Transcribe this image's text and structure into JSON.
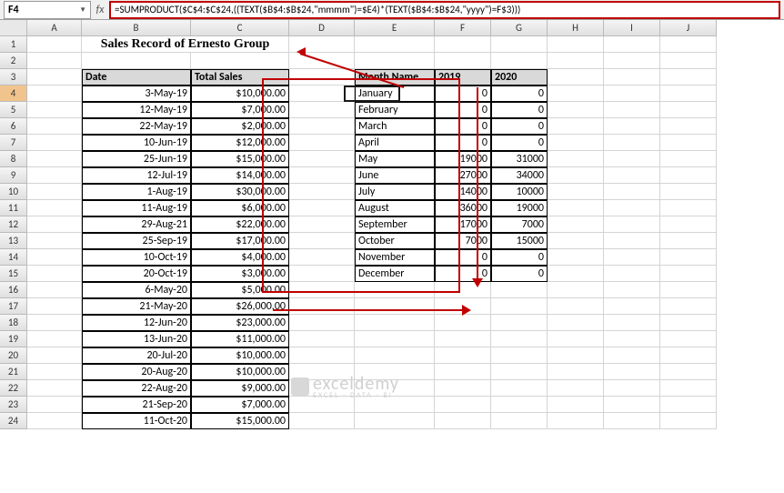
{
  "namebox": "F4",
  "formula": "=SUMPRODUCT($C$4:$C$24,((TEXT($B$4:$B$24,\"mmmm\")=$E4)*(TEXT($B$4:$B$24,\"yyyy\")=F$3)))",
  "title": "Sales Record of Ernesto Group",
  "sales_headers": {
    "date": "Date",
    "total": "Total Sales"
  },
  "sales": [
    {
      "d": "3-May-19",
      "t": "$10,000.00"
    },
    {
      "d": "12-May-19",
      "t": "$7,000.00"
    },
    {
      "d": "22-May-19",
      "t": "$2,000.00"
    },
    {
      "d": "10-Jun-19",
      "t": "$12,000.00"
    },
    {
      "d": "25-Jun-19",
      "t": "$15,000.00"
    },
    {
      "d": "12-Jul-19",
      "t": "$14,000.00"
    },
    {
      "d": "1-Aug-19",
      "t": "$30,000.00"
    },
    {
      "d": "11-Aug-19",
      "t": "$6,000.00"
    },
    {
      "d": "29-Aug-21",
      "t": "$22,000.00"
    },
    {
      "d": "25-Sep-19",
      "t": "$17,000.00"
    },
    {
      "d": "10-Oct-19",
      "t": "$4,000.00"
    },
    {
      "d": "20-Oct-19",
      "t": "$3,000.00"
    },
    {
      "d": "6-May-20",
      "t": "$5,000.00"
    },
    {
      "d": "21-May-20",
      "t": "$26,000.00"
    },
    {
      "d": "12-Jun-20",
      "t": "$23,000.00"
    },
    {
      "d": "13-Jun-20",
      "t": "$11,000.00"
    },
    {
      "d": "20-Jul-20",
      "t": "$10,000.00"
    },
    {
      "d": "20-Aug-20",
      "t": "$10,000.00"
    },
    {
      "d": "22-Aug-20",
      "t": "$9,000.00"
    },
    {
      "d": "21-Sep-20",
      "t": "$7,000.00"
    },
    {
      "d": "11-Oct-20",
      "t": "$15,000.00"
    }
  ],
  "pivot_headers": {
    "mn": "Month Name",
    "y1": "2019",
    "y2": "2020"
  },
  "pivot": [
    {
      "m": "January",
      "a": "0",
      "b": "0"
    },
    {
      "m": "February",
      "a": "0",
      "b": "0"
    },
    {
      "m": "March",
      "a": "0",
      "b": "0"
    },
    {
      "m": "April",
      "a": "0",
      "b": "0"
    },
    {
      "m": "May",
      "a": "19000",
      "b": "31000"
    },
    {
      "m": "June",
      "a": "27000",
      "b": "34000"
    },
    {
      "m": "July",
      "a": "14000",
      "b": "10000"
    },
    {
      "m": "August",
      "a": "36000",
      "b": "19000"
    },
    {
      "m": "September",
      "a": "17000",
      "b": "7000"
    },
    {
      "m": "October",
      "a": "7000",
      "b": "15000"
    },
    {
      "m": "November",
      "a": "0",
      "b": "0"
    },
    {
      "m": "December",
      "a": "0",
      "b": "0"
    }
  ],
  "cols": [
    "A",
    "B",
    "C",
    "D",
    "E",
    "F",
    "G",
    "H",
    "I",
    "J"
  ],
  "watermark": {
    "main": "exceldemy",
    "sub": "EXCEL · DATA · BI"
  },
  "chart_data": {
    "type": "table",
    "title": "Sales Record of Ernesto Group",
    "raw_sales": [
      {
        "date": "3-May-19",
        "value": 10000
      },
      {
        "date": "12-May-19",
        "value": 7000
      },
      {
        "date": "22-May-19",
        "value": 2000
      },
      {
        "date": "10-Jun-19",
        "value": 12000
      },
      {
        "date": "25-Jun-19",
        "value": 15000
      },
      {
        "date": "12-Jul-19",
        "value": 14000
      },
      {
        "date": "1-Aug-19",
        "value": 30000
      },
      {
        "date": "11-Aug-19",
        "value": 6000
      },
      {
        "date": "29-Aug-21",
        "value": 22000
      },
      {
        "date": "25-Sep-19",
        "value": 17000
      },
      {
        "date": "10-Oct-19",
        "value": 4000
      },
      {
        "date": "20-Oct-19",
        "value": 3000
      },
      {
        "date": "6-May-20",
        "value": 5000
      },
      {
        "date": "21-May-20",
        "value": 26000
      },
      {
        "date": "12-Jun-20",
        "value": 23000
      },
      {
        "date": "13-Jun-20",
        "value": 11000
      },
      {
        "date": "20-Jul-20",
        "value": 10000
      },
      {
        "date": "20-Aug-20",
        "value": 10000
      },
      {
        "date": "22-Aug-20",
        "value": 9000
      },
      {
        "date": "21-Sep-20",
        "value": 7000
      },
      {
        "date": "11-Oct-20",
        "value": 15000
      }
    ],
    "pivot_categories": [
      "January",
      "February",
      "March",
      "April",
      "May",
      "June",
      "July",
      "August",
      "September",
      "October",
      "November",
      "December"
    ],
    "series": [
      {
        "name": "2019",
        "values": [
          0,
          0,
          0,
          0,
          19000,
          27000,
          14000,
          36000,
          17000,
          7000,
          0,
          0
        ]
      },
      {
        "name": "2020",
        "values": [
          0,
          0,
          0,
          0,
          31000,
          34000,
          10000,
          19000,
          7000,
          15000,
          0,
          0
        ]
      }
    ]
  }
}
